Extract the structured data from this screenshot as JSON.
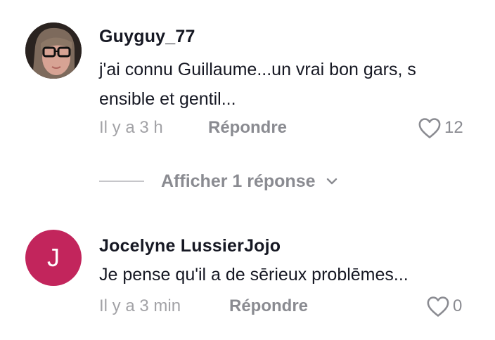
{
  "comments": [
    {
      "username": "Guyguy_77",
      "text": "j'ai connu Guillaume...un vrai bon gars, s ensible et gentil...",
      "time": "Il y a 3 h",
      "reply_label": "Répondre",
      "likes": "12"
    },
    {
      "username": "Jocelyne LussierJojo",
      "avatar_letter": "J",
      "avatar_color": "#c2255c",
      "text": "Je pense qu'il a de sērieux problēmes...",
      "time": "Il y a 3 min",
      "reply_label": "Répondre",
      "likes": "0"
    }
  ],
  "view_replies_label": "Afficher 1 réponse",
  "icons": {
    "like": "heart-outline-icon",
    "expand": "chevron-down-icon"
  }
}
